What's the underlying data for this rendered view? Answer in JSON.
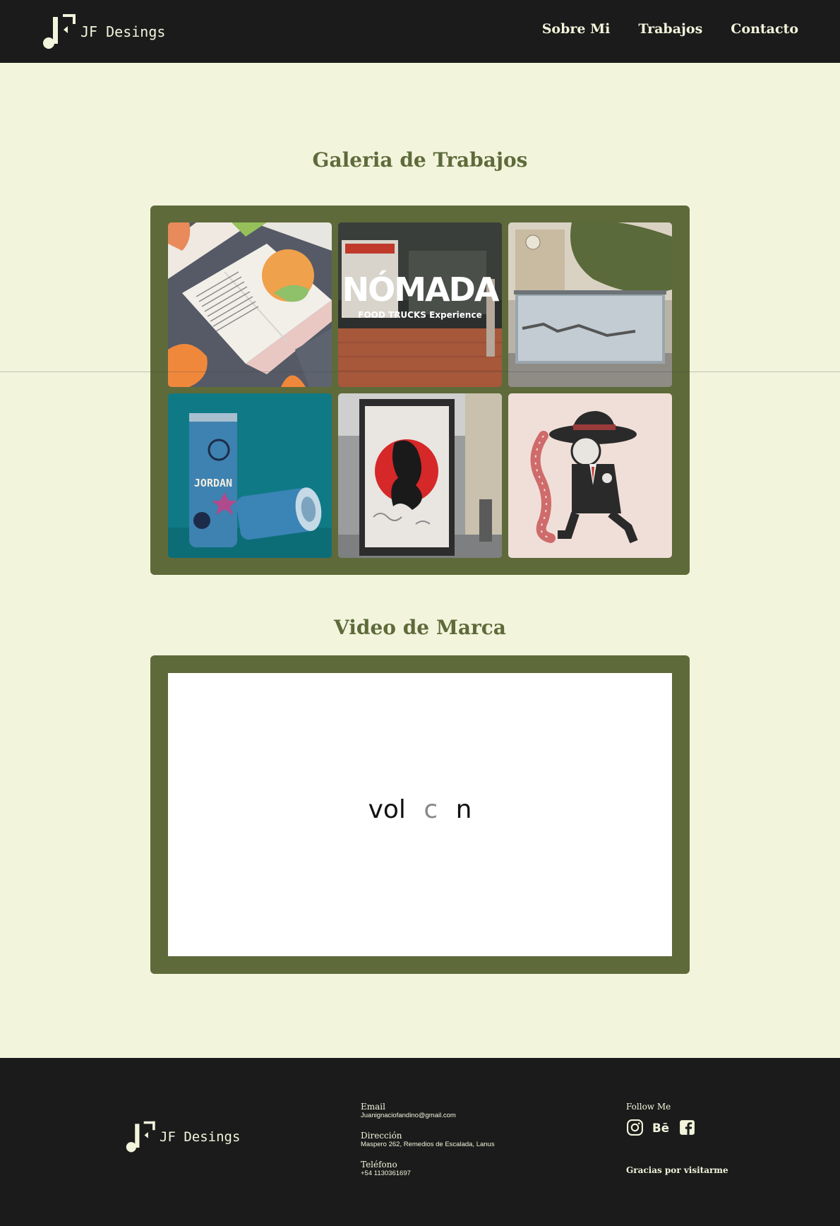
{
  "brand": {
    "name": "JF Desings"
  },
  "nav": {
    "items": [
      "Sobre Mi",
      "Trabajos",
      "Contacto"
    ]
  },
  "gallery": {
    "title": "Galeria de Trabajos",
    "items": [
      {
        "name": "book-illustration"
      },
      {
        "name": "nomada-food-trucks",
        "title": "NÓMADA",
        "subtitle": "FOOD TRUCKS Experience"
      },
      {
        "name": "bus-stop-ad"
      },
      {
        "name": "jordan-beverage-can",
        "label": "JORDAN"
      },
      {
        "name": "samurai-poster"
      },
      {
        "name": "rat-mascot"
      }
    ]
  },
  "video": {
    "title": "Video de Marca",
    "text_parts": [
      "vol",
      "c",
      "n"
    ]
  },
  "footer": {
    "email_label": "Email",
    "email": "Juanignaciofandino@gmail.com",
    "address_label": "Dirección",
    "address": "Maspero 262, Remedios de Escalada, Lanus",
    "phone_label": "Teléfono",
    "phone": "+54 1130361697",
    "follow_label": "Follow Me",
    "social_icons": [
      "instagram-icon",
      "behance-icon",
      "facebook-icon"
    ],
    "thanks": "Gracias por visitarme"
  },
  "colors": {
    "background": "#f3f4dc",
    "dark": "#1b1b1b",
    "olive": "#5e6a3a"
  }
}
